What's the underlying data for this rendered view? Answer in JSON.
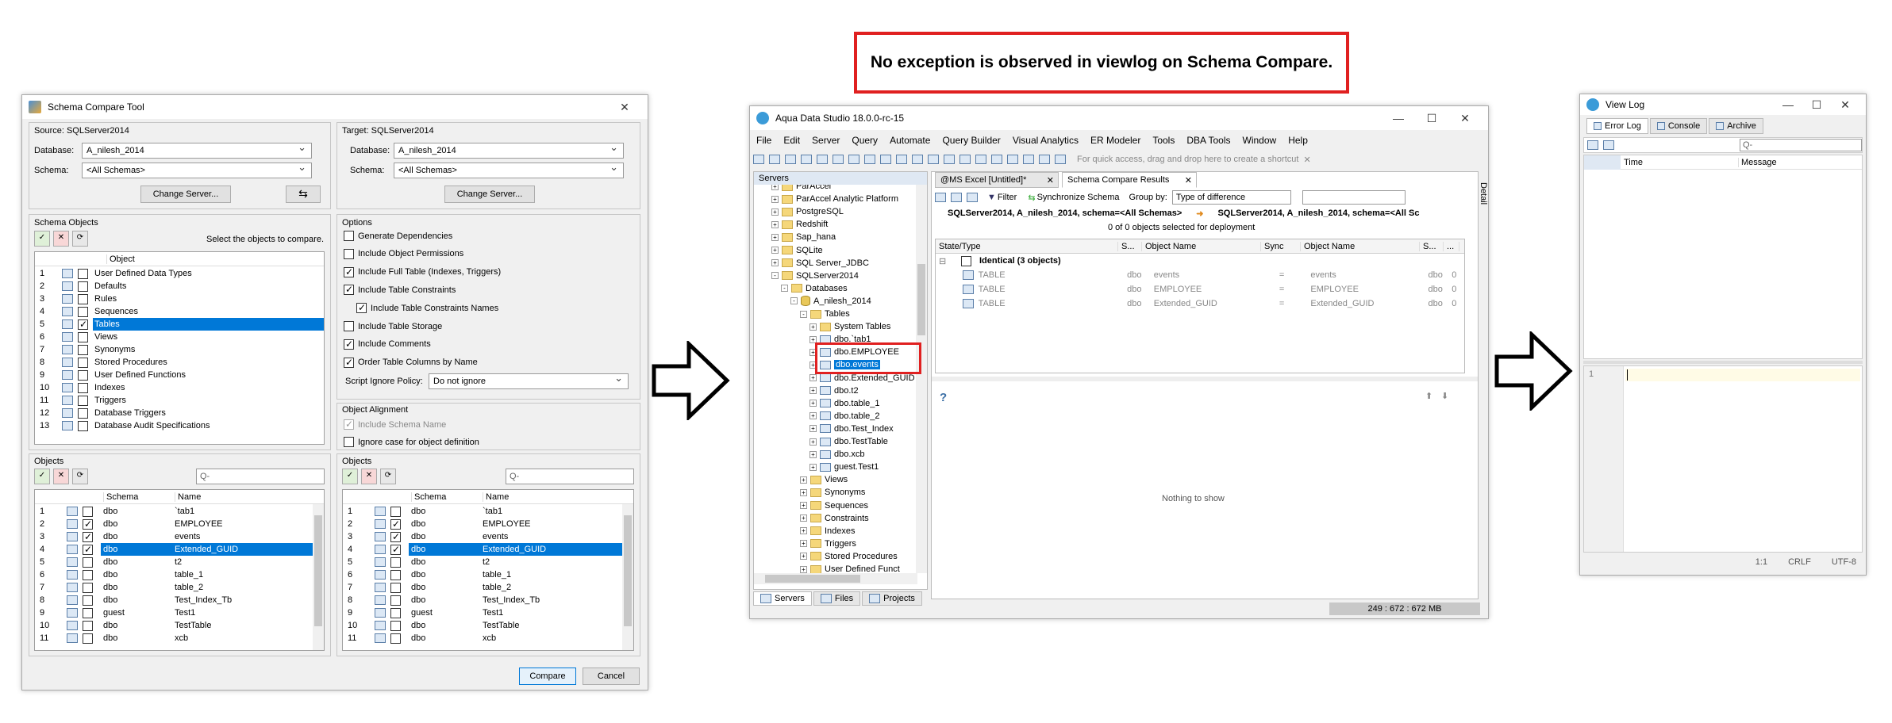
{
  "annotation": {
    "text": "No exception is observed in viewlog on Schema Compare."
  },
  "schema_compare": {
    "title": "Schema Compare Tool",
    "close": "✕",
    "source": {
      "label": "Source: SQLServer2014",
      "db_label": "Database:",
      "db_value": "A_nilesh_2014",
      "schema_label": "Schema:",
      "schema_value": "<All Schemas>",
      "change_server": "Change Server..."
    },
    "target": {
      "label": "Target: SQLServer2014",
      "db_label": "Database:",
      "db_value": "A_nilesh_2014",
      "schema_label": "Schema:",
      "schema_value": "<All Schemas>",
      "change_server": "Change Server..."
    },
    "swap": "⇆",
    "schema_objects": {
      "label": "Schema Objects",
      "hint": "Select the objects to compare.",
      "col_object": "Object",
      "items": [
        {
          "n": "1",
          "name": "User Defined Data Types",
          "checked": false,
          "sel": false
        },
        {
          "n": "2",
          "name": "Defaults",
          "checked": false,
          "sel": false
        },
        {
          "n": "3",
          "name": "Rules",
          "checked": false,
          "sel": false
        },
        {
          "n": "4",
          "name": "Sequences",
          "checked": false,
          "sel": false
        },
        {
          "n": "5",
          "name": "Tables",
          "checked": true,
          "sel": true
        },
        {
          "n": "6",
          "name": "Views",
          "checked": false,
          "sel": false
        },
        {
          "n": "7",
          "name": "Synonyms",
          "checked": false,
          "sel": false
        },
        {
          "n": "8",
          "name": "Stored Procedures",
          "checked": false,
          "sel": false
        },
        {
          "n": "9",
          "name": "User Defined Functions",
          "checked": false,
          "sel": false
        },
        {
          "n": "10",
          "name": "Indexes",
          "checked": false,
          "sel": false
        },
        {
          "n": "11",
          "name": "Triggers",
          "checked": false,
          "sel": false
        },
        {
          "n": "12",
          "name": "Database Triggers",
          "checked": false,
          "sel": false
        },
        {
          "n": "13",
          "name": "Database Audit Specifications",
          "checked": false,
          "sel": false
        }
      ]
    },
    "options": {
      "label": "Options",
      "items": [
        {
          "text": "Generate Dependencies",
          "checked": false,
          "indent": false
        },
        {
          "text": "Include Object Permissions",
          "checked": false,
          "indent": false
        },
        {
          "text": "Include Full Table (Indexes, Triggers)",
          "checked": true,
          "indent": false
        },
        {
          "text": "Include Table Constraints",
          "checked": true,
          "indent": false
        },
        {
          "text": "Include Table Constraints Names",
          "checked": true,
          "indent": true
        },
        {
          "text": "Include Table Storage",
          "checked": false,
          "indent": false
        },
        {
          "text": "Include Comments",
          "checked": true,
          "indent": false
        },
        {
          "text": "Order Table Columns by Name",
          "checked": true,
          "indent": false
        }
      ],
      "ignore_label": "Script Ignore Policy:",
      "ignore_value": "Do not ignore"
    },
    "alignment": {
      "label": "Object Alignment",
      "include_schema": "Include Schema Name",
      "ignore_case": "Ignore case for object definition"
    },
    "objects_label": "Objects",
    "search_placeholder": "Q-",
    "col_schema": "Schema",
    "col_name": "Name",
    "src_rows": [
      {
        "n": "1",
        "schema": "dbo",
        "name": "`tab1",
        "checked": false,
        "sel": false
      },
      {
        "n": "2",
        "schema": "dbo",
        "name": "EMPLOYEE",
        "checked": true,
        "sel": false
      },
      {
        "n": "3",
        "schema": "dbo",
        "name": "events",
        "checked": true,
        "sel": false
      },
      {
        "n": "4",
        "schema": "dbo",
        "name": "Extended_GUID",
        "checked": true,
        "sel": true
      },
      {
        "n": "5",
        "schema": "dbo",
        "name": "t2",
        "checked": false,
        "sel": false
      },
      {
        "n": "6",
        "schema": "dbo",
        "name": "table_1",
        "checked": false,
        "sel": false
      },
      {
        "n": "7",
        "schema": "dbo",
        "name": "table_2",
        "checked": false,
        "sel": false
      },
      {
        "n": "8",
        "schema": "dbo",
        "name": "Test_Index_Tb",
        "checked": false,
        "sel": false
      },
      {
        "n": "9",
        "schema": "guest",
        "name": "Test1",
        "checked": false,
        "sel": false
      },
      {
        "n": "10",
        "schema": "dbo",
        "name": "TestTable",
        "checked": false,
        "sel": false
      },
      {
        "n": "11",
        "schema": "dbo",
        "name": "xcb",
        "checked": false,
        "sel": false
      }
    ],
    "tgt_rows": [
      {
        "n": "1",
        "schema": "dbo",
        "name": "`tab1",
        "checked": false,
        "sel": false
      },
      {
        "n": "2",
        "schema": "dbo",
        "name": "EMPLOYEE",
        "checked": true,
        "sel": false
      },
      {
        "n": "3",
        "schema": "dbo",
        "name": "events",
        "checked": true,
        "sel": false
      },
      {
        "n": "4",
        "schema": "dbo",
        "name": "Extended_GUID",
        "checked": true,
        "sel": true
      },
      {
        "n": "5",
        "schema": "dbo",
        "name": "t2",
        "checked": false,
        "sel": false
      },
      {
        "n": "6",
        "schema": "dbo",
        "name": "table_1",
        "checked": false,
        "sel": false
      },
      {
        "n": "7",
        "schema": "dbo",
        "name": "table_2",
        "checked": false,
        "sel": false
      },
      {
        "n": "8",
        "schema": "dbo",
        "name": "Test_Index_Tb",
        "checked": false,
        "sel": false
      },
      {
        "n": "9",
        "schema": "guest",
        "name": "Test1",
        "checked": false,
        "sel": false
      },
      {
        "n": "10",
        "schema": "dbo",
        "name": "TestTable",
        "checked": false,
        "sel": false
      },
      {
        "n": "11",
        "schema": "dbo",
        "name": "xcb",
        "checked": false,
        "sel": false
      }
    ],
    "compare": "Compare",
    "cancel": "Cancel"
  },
  "ads": {
    "title": "Aqua Data Studio 18.0.0-rc-15",
    "menu": [
      "File",
      "Edit",
      "Server",
      "Query",
      "Automate",
      "Query Builder",
      "Visual Analytics",
      "ER Modeler",
      "Tools",
      "DBA Tools",
      "Window",
      "Help"
    ],
    "quick_access": "For quick access, drag and drop here to create a shortcut",
    "servers_label": "Servers",
    "tree": [
      {
        "text": "ParAccel",
        "depth": 1,
        "icon": "fold",
        "exp": "+"
      },
      {
        "text": "ParAccel Analytic Platform",
        "depth": 1,
        "icon": "fold",
        "exp": "+"
      },
      {
        "text": "PostgreSQL",
        "depth": 1,
        "icon": "fold",
        "exp": "+"
      },
      {
        "text": "Redshift",
        "depth": 1,
        "icon": "fold",
        "exp": "+"
      },
      {
        "text": "Sap_hana",
        "depth": 1,
        "icon": "fold",
        "exp": "+"
      },
      {
        "text": "SQLite",
        "depth": 1,
        "icon": "fold",
        "exp": "+"
      },
      {
        "text": "SQL Server_JDBC",
        "depth": 1,
        "icon": "fold",
        "exp": "+"
      },
      {
        "text": "SQLServer2014",
        "depth": 1,
        "icon": "fold",
        "exp": "-"
      },
      {
        "text": "Databases",
        "depth": 2,
        "icon": "fold",
        "exp": "-"
      },
      {
        "text": "A_nilesh_2014",
        "depth": 3,
        "icon": "db",
        "exp": "-"
      },
      {
        "text": "Tables",
        "depth": 4,
        "icon": "fold",
        "exp": "-"
      },
      {
        "text": "System Tables",
        "depth": 5,
        "icon": "fold",
        "exp": "+"
      },
      {
        "text": "dbo.`tab1",
        "depth": 5,
        "icon": "tabl",
        "exp": "+"
      },
      {
        "text": "dbo.EMPLOYEE",
        "depth": 5,
        "icon": "tabl",
        "exp": "+"
      },
      {
        "text": "dbo.events",
        "depth": 5,
        "icon": "tabl",
        "exp": "+",
        "sel": true
      },
      {
        "text": "dbo.Extended_GUID",
        "depth": 5,
        "icon": "tabl",
        "exp": "+"
      },
      {
        "text": "dbo.t2",
        "depth": 5,
        "icon": "tabl",
        "exp": "+"
      },
      {
        "text": "dbo.table_1",
        "depth": 5,
        "icon": "tabl",
        "exp": "+"
      },
      {
        "text": "dbo.table_2",
        "depth": 5,
        "icon": "tabl",
        "exp": "+"
      },
      {
        "text": "dbo.Test_Index",
        "depth": 5,
        "icon": "tabl",
        "exp": "+"
      },
      {
        "text": "dbo.TestTable",
        "depth": 5,
        "icon": "tabl",
        "exp": "+"
      },
      {
        "text": "dbo.xcb",
        "depth": 5,
        "icon": "tabl",
        "exp": "+"
      },
      {
        "text": "guest.Test1",
        "depth": 5,
        "icon": "tabl",
        "exp": "+"
      },
      {
        "text": "Views",
        "depth": 4,
        "icon": "fold",
        "exp": "+"
      },
      {
        "text": "Synonyms",
        "depth": 4,
        "icon": "fold",
        "exp": "+"
      },
      {
        "text": "Sequences",
        "depth": 4,
        "icon": "fold",
        "exp": "+"
      },
      {
        "text": "Constraints",
        "depth": 4,
        "icon": "fold",
        "exp": "+"
      },
      {
        "text": "Indexes",
        "depth": 4,
        "icon": "fold",
        "exp": "+"
      },
      {
        "text": "Triggers",
        "depth": 4,
        "icon": "fold",
        "exp": "+"
      },
      {
        "text": "Stored Procedures",
        "depth": 4,
        "icon": "fold",
        "exp": "+"
      },
      {
        "text": "User Defined Funct",
        "depth": 4,
        "icon": "fold",
        "exp": "+"
      }
    ],
    "bottom_tabs": [
      "Servers",
      "Files",
      "Projects"
    ],
    "doc_tabs": [
      {
        "label": "@MS Excel [Untitled]*",
        "active": false
      },
      {
        "label": "Schema Compare Results",
        "active": true
      }
    ],
    "filter": "Filter",
    "sync": "Synchronize Schema",
    "group_by": "Group by:",
    "group_value": "Type of difference",
    "src_desc": "SQLServer2014, A_nilesh_2014,  schema=<All Schemas>",
    "tgt_desc": "SQLServer2014, A_nilesh_2014,  schema=<All Sc",
    "deploy": "0 of 0 objects selected for deployment",
    "cols": [
      "State/Type",
      "S...",
      "Object Name",
      "Sync",
      "Object Name",
      "S...",
      "..."
    ],
    "group_row": "Identical (3 objects)",
    "rows": [
      {
        "type": "TABLE",
        "schema": "dbo",
        "name": "events",
        "sync": "=",
        "tname": "events",
        "ts": "dbo",
        "x": "0"
      },
      {
        "type": "TABLE",
        "schema": "dbo",
        "name": "EMPLOYEE",
        "sync": "=",
        "tname": "EMPLOYEE",
        "ts": "dbo",
        "x": "0"
      },
      {
        "type": "TABLE",
        "schema": "dbo",
        "name": "Extended_GUID",
        "sync": "=",
        "tname": "Extended_GUID",
        "ts": "dbo",
        "x": "0"
      }
    ],
    "nothing": "Nothing to show",
    "help": "?",
    "detail": "Detail",
    "memory": "249 : 672 : 672 MB"
  },
  "viewlog": {
    "title": "View Log",
    "tabs": [
      "Error Log",
      "Console",
      "Archive"
    ],
    "search": "Q-",
    "col_time": "Time",
    "col_message": "Message",
    "line": "1",
    "status": [
      "1:1",
      "CRLF",
      "UTF-8"
    ]
  },
  "colors": {
    "accent": "#0078d7",
    "highlight": "#e02020",
    "selection": "#0078d7"
  }
}
